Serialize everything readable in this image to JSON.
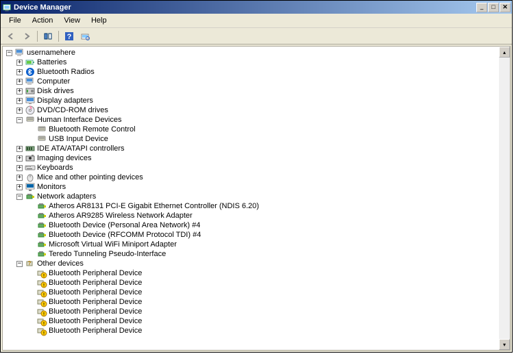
{
  "window": {
    "title": "Device Manager"
  },
  "menu": {
    "file": "File",
    "action": "Action",
    "view": "View",
    "help": "Help"
  },
  "tree": {
    "root": "usernamehere",
    "categories": [
      {
        "label": "Batteries",
        "icon": "battery",
        "expandable": true,
        "expanded": false
      },
      {
        "label": "Bluetooth Radios",
        "icon": "bt",
        "expandable": true,
        "expanded": false
      },
      {
        "label": "Computer",
        "icon": "computer",
        "expandable": true,
        "expanded": false
      },
      {
        "label": "Disk drives",
        "icon": "disk",
        "expandable": true,
        "expanded": false
      },
      {
        "label": "Display adapters",
        "icon": "display",
        "expandable": true,
        "expanded": false
      },
      {
        "label": "DVD/CD-ROM drives",
        "icon": "cd",
        "expandable": true,
        "expanded": false
      },
      {
        "label": "Human Interface Devices",
        "icon": "hid",
        "expandable": true,
        "expanded": true,
        "children": [
          {
            "label": "Bluetooth Remote Control",
            "icon": "hid"
          },
          {
            "label": "USB Input Device",
            "icon": "hid"
          }
        ]
      },
      {
        "label": "IDE ATA/ATAPI controllers",
        "icon": "ide",
        "expandable": true,
        "expanded": false
      },
      {
        "label": "Imaging devices",
        "icon": "imaging",
        "expandable": true,
        "expanded": false
      },
      {
        "label": "Keyboards",
        "icon": "keyboard",
        "expandable": true,
        "expanded": false
      },
      {
        "label": "Mice and other pointing devices",
        "icon": "mouse",
        "expandable": true,
        "expanded": false
      },
      {
        "label": "Monitors",
        "icon": "monitor",
        "expandable": true,
        "expanded": false
      },
      {
        "label": "Network adapters",
        "icon": "net",
        "expandable": true,
        "expanded": true,
        "children": [
          {
            "label": "Atheros AR8131 PCI-E Gigabit Ethernet Controller (NDIS 6.20)",
            "icon": "netcard"
          },
          {
            "label": "Atheros AR9285 Wireless Network Adapter",
            "icon": "netcard"
          },
          {
            "label": "Bluetooth Device (Personal Area Network) #4",
            "icon": "netcard"
          },
          {
            "label": "Bluetooth Device (RFCOMM Protocol TDI) #4",
            "icon": "netcard"
          },
          {
            "label": "Microsoft Virtual WiFi Miniport Adapter",
            "icon": "netcard"
          },
          {
            "label": "Teredo Tunneling Pseudo-Interface",
            "icon": "netcard"
          }
        ]
      },
      {
        "label": "Other devices",
        "icon": "other",
        "expandable": true,
        "expanded": true,
        "children": [
          {
            "label": "Bluetooth Peripheral Device",
            "icon": "warn"
          },
          {
            "label": "Bluetooth Peripheral Device",
            "icon": "warn"
          },
          {
            "label": "Bluetooth Peripheral Device",
            "icon": "warn"
          },
          {
            "label": "Bluetooth Peripheral Device",
            "icon": "warn"
          },
          {
            "label": "Bluetooth Peripheral Device",
            "icon": "warn"
          },
          {
            "label": "Bluetooth Peripheral Device",
            "icon": "warn"
          },
          {
            "label": "Bluetooth Peripheral Device",
            "icon": "warn"
          }
        ]
      }
    ]
  }
}
